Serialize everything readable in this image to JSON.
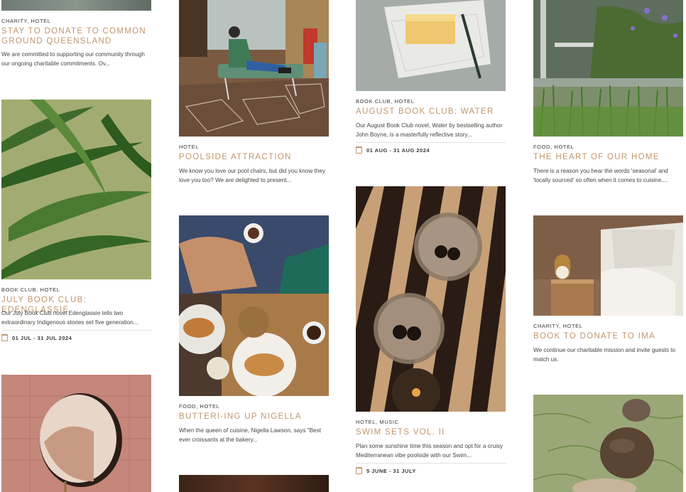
{
  "cards": [
    {
      "id": "c1",
      "category": "CHARITY, HOTEL",
      "title": "STAY TO DONATE TO COMMON GROUND QUEENSLAND",
      "desc": "We are committed to supporting our community through our ongoing charitable commitments. Ov..."
    },
    {
      "id": "c2",
      "category": "BOOK CLUB, HOTEL",
      "title": "JULY BOOK CLUB: EDENGLASSIE",
      "desc": "Our July Book Club novel Edenglassie tells two extraordinary Indigenous stories set five generation...",
      "date": "01 JUL - 31 JUL 2024"
    },
    {
      "id": "c3",
      "category": "HOTEL",
      "title": "POOLSIDE ATTRACTION",
      "desc": "We know you love our pool chairs, but did you know they love you too? We are delighted to present..."
    },
    {
      "id": "c4",
      "category": "FOOD, HOTEL",
      "title": "BUTTERI-ING UP NIGELLA",
      "desc": "When the queen of cuisine, Nigella Lawson, says \"Best ever croissants at the bakery..."
    },
    {
      "id": "c5",
      "category": "BOOK CLUB, HOTEL",
      "title": "AUGUST BOOK CLUB: WATER",
      "desc": "Our August Book Club novel, Water by bestselling author John Boyne, is a masterfully reflective story...",
      "date": "01 AUG - 31 AUG 2024"
    },
    {
      "id": "c6",
      "category": "HOTEL, MUSIC",
      "title": "SWIM SETS VOL. II",
      "desc": "Plan some sunshine time this season and opt for a cruisy Mediterranean vibe poolside with our Swim...",
      "date": "5 JUNE - 31 JULY"
    },
    {
      "id": "c7",
      "category": "FOOD, HOTEL",
      "title": "THE HEART OF OUR HOME",
      "desc": "There is a reason you hear the words 'seasonal' and 'locally sourced' so often when it comes to cuisine...."
    },
    {
      "id": "c8",
      "category": "CHARITY, HOTEL",
      "title": "BOOK TO DONATE TO IMA",
      "desc": "We continue our charitable mission and invite guests to match us."
    }
  ],
  "images": {
    "top_left": "landscape photo",
    "leaves": "green leaves photo",
    "mirror": "round mirror on pink tiles photo",
    "poolside": "person lounging on pool chair photo",
    "croissants": "croissants and coffee photo",
    "bottom_mid": "dark interior photo",
    "butter": "butter on paper photo",
    "martinis": "martini glasses with shadows photo",
    "garden": "garden plants photo",
    "bedroom": "bedroom with lamp photo",
    "stones": "stacked stones on moss photo"
  }
}
